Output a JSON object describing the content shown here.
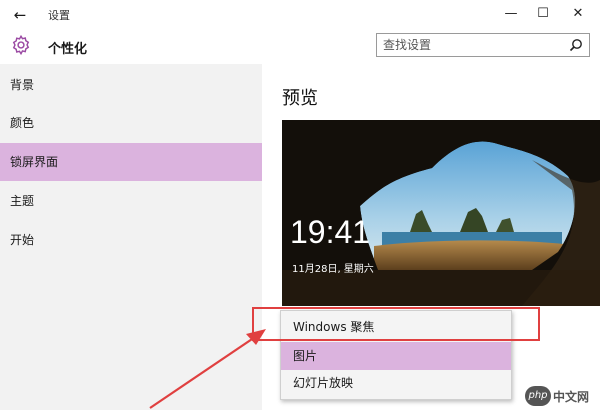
{
  "window": {
    "back_glyph": "←",
    "app_title": "设置",
    "minimize_glyph": "—",
    "maximize_glyph": "☐",
    "close_glyph": "✕"
  },
  "header": {
    "icon": "gear-icon",
    "title": "个性化",
    "search_placeholder": "查找设置"
  },
  "sidebar": {
    "items": [
      {
        "label": "背景",
        "active": false
      },
      {
        "label": "颜色",
        "active": false
      },
      {
        "label": "锁屏界面",
        "active": true
      },
      {
        "label": "主题",
        "active": false
      },
      {
        "label": "开始",
        "active": false
      }
    ]
  },
  "main": {
    "preview_heading": "预览",
    "lock_time": "19:41",
    "lock_date": "11月28日, 星期六"
  },
  "dropdown": {
    "options": [
      {
        "label": "Windows 聚焦",
        "selected": false
      },
      {
        "label": "图片",
        "selected": true
      },
      {
        "label": "幻灯片放映",
        "selected": false
      }
    ]
  },
  "colors": {
    "accent": "#dbb3de",
    "annotation": "#e04040"
  },
  "watermark": {
    "badge": "php",
    "text": "中文网"
  }
}
